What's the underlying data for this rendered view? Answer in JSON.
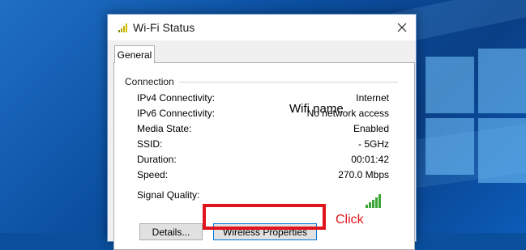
{
  "window": {
    "title": "Wi-Fi Status",
    "close_glyph": "✕"
  },
  "tabs": [
    {
      "label": "General"
    }
  ],
  "connection": {
    "group_label": "Connection",
    "rows": [
      {
        "label": "IPv4 Connectivity:",
        "value": "Internet"
      },
      {
        "label": "IPv6 Connectivity:",
        "value": "No network access"
      },
      {
        "label": "Media State:",
        "value": "Enabled"
      },
      {
        "label": "SSID:",
        "value": "- 5GHz"
      },
      {
        "label": "Duration:",
        "value": "00:01:42"
      },
      {
        "label": "Speed:",
        "value": "270.0 Mbps"
      }
    ],
    "signal_quality_label": "Signal Quality:"
  },
  "annotations": {
    "ssid_overlay": "Wifi name",
    "click_label": "Click",
    "highlight_color": "#e0141c"
  },
  "buttons": {
    "details": "Details...",
    "wireless_properties": "Wireless Properties"
  },
  "icons": {
    "title": "wifi-signal-icon",
    "signal": "signal-bars-icon",
    "close": "close-icon"
  },
  "colors": {
    "signal_green": "#3aa635",
    "focus_border": "#0078d7",
    "desktop_blue": "#0b4fa0"
  }
}
